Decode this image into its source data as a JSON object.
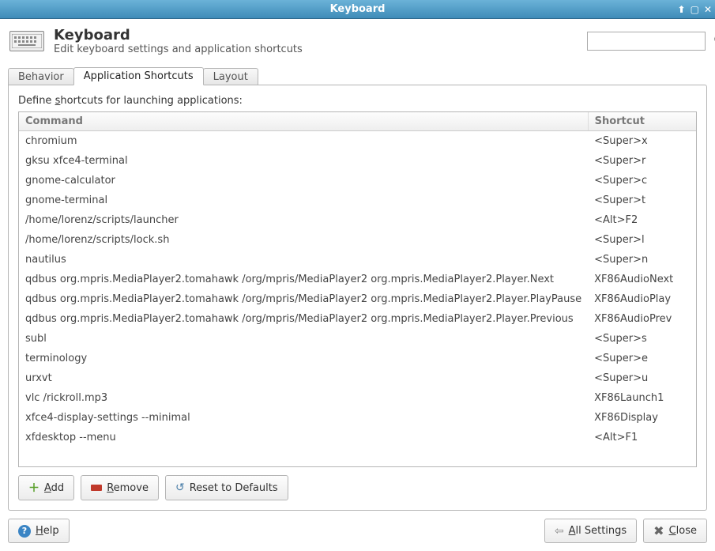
{
  "window": {
    "title": "Keyboard"
  },
  "header": {
    "title": "Keyboard",
    "subtitle": "Edit keyboard settings and application shortcuts"
  },
  "search": {
    "placeholder": ""
  },
  "tabs": {
    "behavior": "Behavior",
    "app_shortcuts": "Application Shortcuts",
    "layout": "Layout",
    "active": "app_shortcuts"
  },
  "hint_prefix": "Define ",
  "hint_underlined": "s",
  "hint_rest": "hortcuts for launching applications:",
  "columns": {
    "command": "Command",
    "shortcut": "Shortcut"
  },
  "rows": [
    {
      "command": "chromium",
      "shortcut": "<Super>x"
    },
    {
      "command": "gksu xfce4-terminal",
      "shortcut": "<Super>r"
    },
    {
      "command": "gnome-calculator",
      "shortcut": "<Super>c"
    },
    {
      "command": "gnome-terminal",
      "shortcut": "<Super>t"
    },
    {
      "command": "/home/lorenz/scripts/launcher",
      "shortcut": "<Alt>F2"
    },
    {
      "command": "/home/lorenz/scripts/lock.sh",
      "shortcut": "<Super>l"
    },
    {
      "command": "nautilus",
      "shortcut": "<Super>n"
    },
    {
      "command": "qdbus org.mpris.MediaPlayer2.tomahawk  /org/mpris/MediaPlayer2 org.mpris.MediaPlayer2.Player.Next",
      "shortcut": "XF86AudioNext"
    },
    {
      "command": "qdbus org.mpris.MediaPlayer2.tomahawk  /org/mpris/MediaPlayer2 org.mpris.MediaPlayer2.Player.PlayPause",
      "shortcut": "XF86AudioPlay"
    },
    {
      "command": "qdbus org.mpris.MediaPlayer2.tomahawk  /org/mpris/MediaPlayer2 org.mpris.MediaPlayer2.Player.Previous",
      "shortcut": "XF86AudioPrev"
    },
    {
      "command": "subl",
      "shortcut": "<Super>s"
    },
    {
      "command": "terminology",
      "shortcut": "<Super>e"
    },
    {
      "command": "urxvt",
      "shortcut": "<Super>u"
    },
    {
      "command": "vlc /rickroll.mp3",
      "shortcut": "XF86Launch1"
    },
    {
      "command": "xfce4-display-settings --minimal",
      "shortcut": "XF86Display"
    },
    {
      "command": "xfdesktop --menu",
      "shortcut": "<Alt>F1"
    }
  ],
  "buttons": {
    "add_u": "A",
    "add_rest": "dd",
    "remove_u": "R",
    "remove_rest": "emove",
    "reset": "Reset to Defaults",
    "help_u": "H",
    "help_rest": "elp",
    "all_settings_u": "A",
    "all_settings_rest": "ll Settings",
    "close_u": "C",
    "close_rest": "lose"
  }
}
